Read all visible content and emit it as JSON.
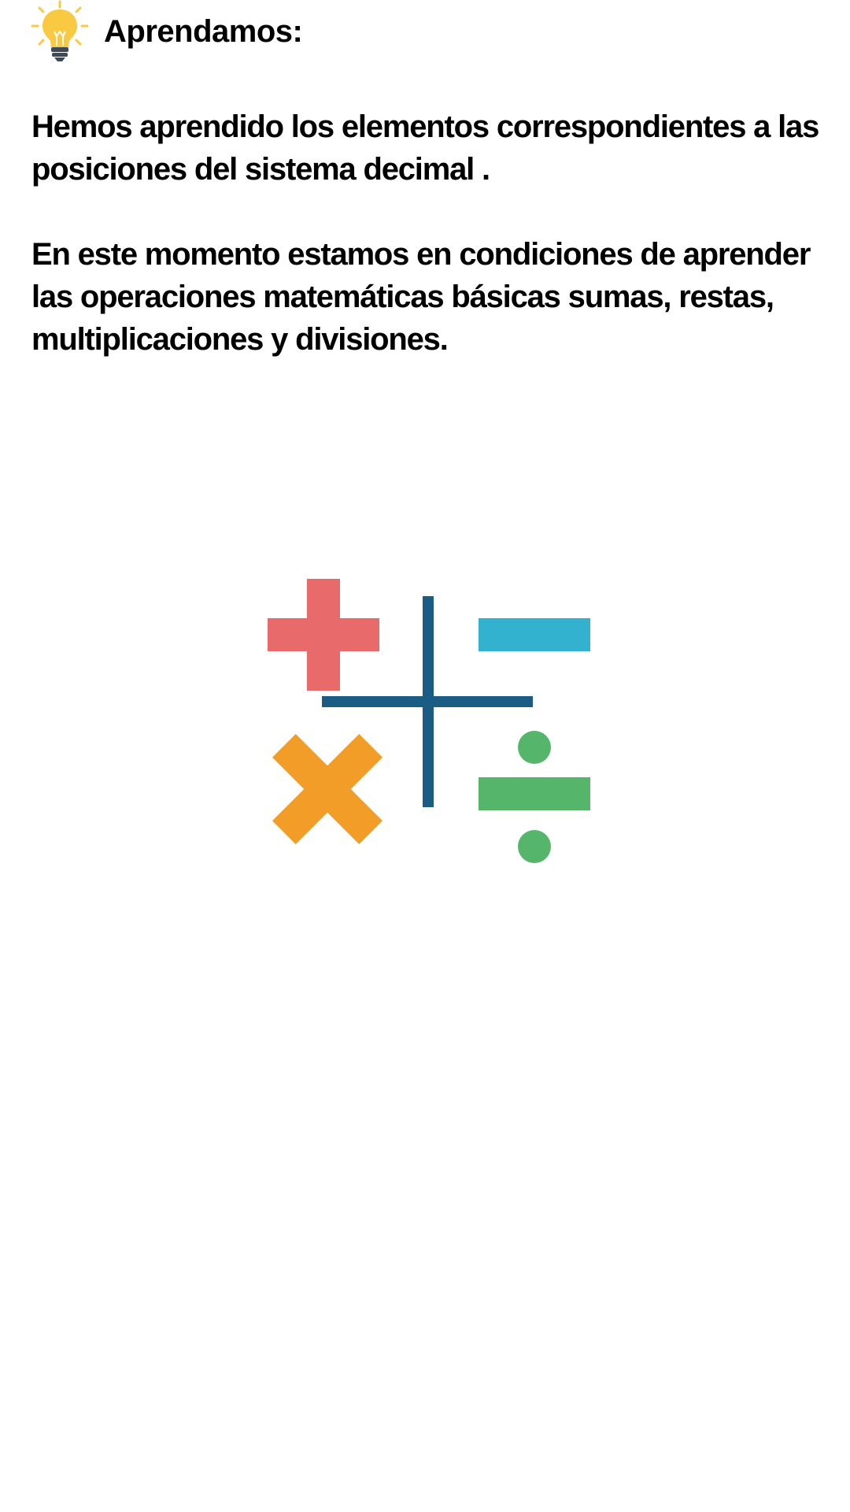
{
  "header": {
    "icon": "lightbulb-icon",
    "title": "Aprendamos:"
  },
  "paragraphs": [
    "Hemos aprendido los elementos correspondientes a las posiciones del sistema decimal .",
    "En este momento estamos en condiciones de aprender las operaciones matemáticas básicas sumas, restas, multiplicaciones y divisiones."
  ],
  "illustration": {
    "icon": "math-operations-icon",
    "colors": {
      "plus": "#e86a6a",
      "minus": "#33b2cf",
      "times": "#f29d27",
      "divide": "#55b56b",
      "cross": "#1b5c84"
    }
  },
  "colors": {
    "bulb": "#f9c942",
    "bulb_base": "#3c4a5c",
    "text": "#000000",
    "background": "#ffffff"
  }
}
